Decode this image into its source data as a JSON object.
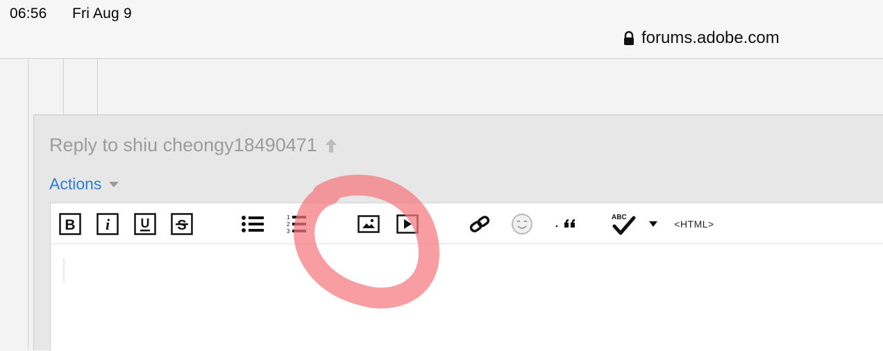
{
  "status_bar": {
    "time": "06:56",
    "date": "Fri Aug 9",
    "url": "forums.adobe.com",
    "icons": [
      "lock-icon"
    ]
  },
  "reply": {
    "title": "Reply to shiu cheongy18490471",
    "title_icon": "arrow-up-icon",
    "actions_label": "Actions",
    "actions_icon": "caret-down-icon"
  },
  "editor": {
    "toolbar": {
      "html_label": "<HTML>",
      "spellcheck_text": "ABC",
      "buttons": [
        "bold-icon",
        "italic-icon",
        "underline-icon",
        "strikethrough-icon",
        "bulleted-list-icon",
        "numbered-list-icon",
        "image-icon",
        "video-icon",
        "link-icon",
        "emoji-icon",
        "quote-icon",
        "spellcheck-icon",
        "dropdown-caret-icon"
      ]
    }
  },
  "colors": {
    "link_blue": "#2e7bd2",
    "muted_text": "#9c9c9c",
    "annotation_red": "#f5787e"
  }
}
